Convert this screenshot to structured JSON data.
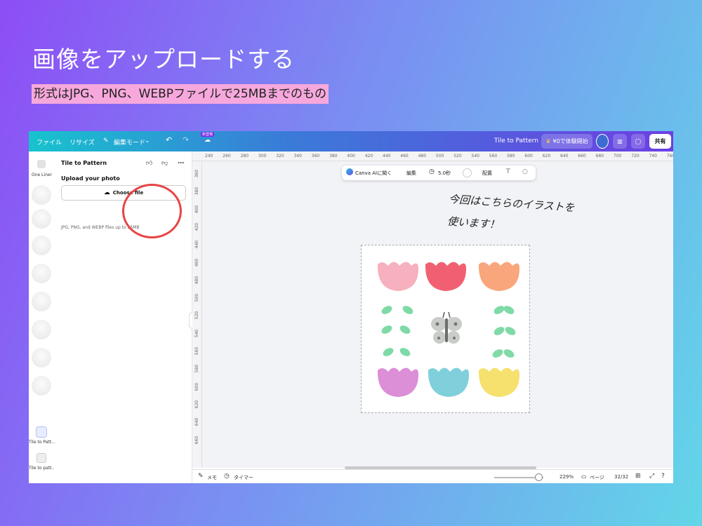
{
  "slide": {
    "title": "画像をアップロードする",
    "subtitle": "形式はJPG、PNG、WEBPファイルで25MBまでのもの"
  },
  "topbar": {
    "file": "ファイル",
    "resize": "リサイズ",
    "edit_mode": "編集モード",
    "new_badge": "新登場",
    "doc_title": "Tile to Pattern",
    "trial_button": "¥0で体験開始",
    "share_button": "共有"
  },
  "rail": {
    "items": [
      {
        "label": "One Liner"
      },
      {
        "label": "Tile to Patt..."
      },
      {
        "label": "Tile to patt..."
      }
    ]
  },
  "panel": {
    "title": "Tile to Pattern",
    "upload_heading": "Upload your photo",
    "choose_button": "Choose file",
    "note": "JPG, PNG, and WEBP files up to 25MB"
  },
  "rulers": {
    "top": [
      "240",
      "260",
      "280",
      "300",
      "320",
      "340",
      "360",
      "380",
      "400",
      "420",
      "440",
      "460",
      "480",
      "500",
      "520",
      "540",
      "560",
      "580",
      "600",
      "620",
      "640",
      "660",
      "680",
      "700",
      "720",
      "740",
      "760"
    ],
    "left": [
      "360",
      "380",
      "400",
      "420",
      "440",
      "460",
      "480",
      "500",
      "520",
      "540",
      "560",
      "580",
      "600",
      "620",
      "640",
      "660"
    ]
  },
  "float_toolbar": {
    "ai": "Canva AIに聞く",
    "edit": "編集",
    "duration": "5.0秒",
    "arrange": "配置"
  },
  "annotation": {
    "line1": "今回はこちらのイラストを",
    "line2": "使います！"
  },
  "illustration": {
    "tulip_colors": [
      "#f6a5b4",
      "#ef4a5e",
      "#f89a6a",
      "#d77ed0",
      "#6ec9d6",
      "#f5dc5a"
    ],
    "leaf_color": "#7fdaa6",
    "butterfly_color": "#c9ccc9"
  },
  "bottombar": {
    "memo": "メモ",
    "timer": "タイマー",
    "zoom": "229%",
    "pages_label": "ページ",
    "page_count": "32/32",
    "zoom_level": 0.9
  }
}
